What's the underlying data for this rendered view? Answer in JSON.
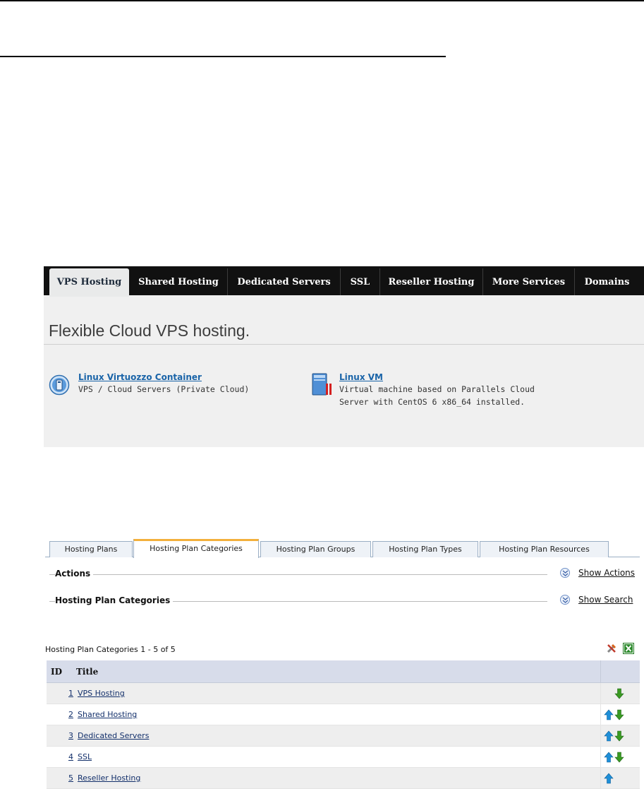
{
  "site_nav": {
    "tabs": [
      "VPS Hosting",
      "Shared Hosting",
      "Dedicated Servers",
      "SSL",
      "Reseller Hosting",
      "More Services",
      "Domains"
    ],
    "active_tab": "VPS Hosting",
    "hero_title": "Flexible Cloud VPS hosting.",
    "services": [
      {
        "title": "Linux Virtuozzo Container",
        "desc": "VPS / Cloud Servers (Private Cloud)",
        "icon": "container-icon"
      },
      {
        "title": "Linux VM",
        "desc": "Virtual machine based on Parallels Cloud",
        "desc2": "Server with CentOS 6 x86_64 installed.",
        "icon": "server-vm-icon"
      }
    ]
  },
  "admin": {
    "tabs": [
      "Hosting Plans",
      "Hosting Plan Categories",
      "Hosting Plan Groups",
      "Hosting Plan Types",
      "Hosting Plan Resources"
    ],
    "active_tab": "Hosting Plan Categories",
    "actions_label": "Actions",
    "show_actions": "Show Actions",
    "categories_label": "Hosting Plan Categories",
    "show_search": "Show Search",
    "summary": "Hosting Plan Categories 1 - 5 of 5",
    "columns": [
      "ID",
      "Title"
    ],
    "rows": [
      {
        "id": "1",
        "title": "VPS Hosting",
        "up": false,
        "down": true
      },
      {
        "id": "2",
        "title": "Shared Hosting",
        "up": true,
        "down": true
      },
      {
        "id": "3",
        "title": "Dedicated Servers",
        "up": true,
        "down": true
      },
      {
        "id": "4",
        "title": "SSL",
        "up": true,
        "down": true
      },
      {
        "id": "5",
        "title": "Reseller Hosting",
        "up": true,
        "down": false
      }
    ],
    "colors": {
      "up_arrow": "#1e8fd8",
      "down_arrow": "#3a9a22",
      "tab_accent": "#f3b03c"
    }
  }
}
